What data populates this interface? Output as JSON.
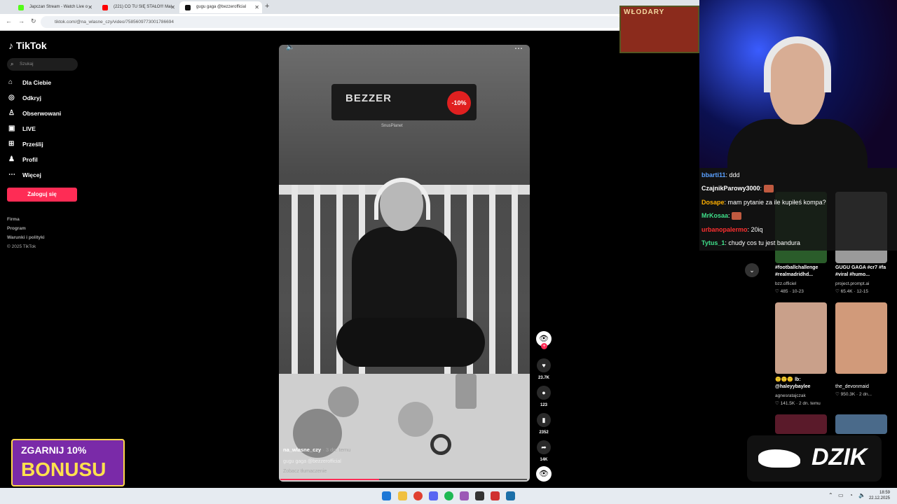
{
  "browser": {
    "tabs": [
      {
        "title": "Japczan Stream - Watch Live o",
        "fav_color": "#53fc18"
      },
      {
        "title": "(221) CO TU SIĘ STAŁO!!! Mai",
        "fav_color": "#ff0000"
      },
      {
        "title": "gugu gaga @bezzerofficial",
        "fav_color": "#111111"
      }
    ],
    "url": "tiktok.com/@na_wlasne_czy/video/7585609773001786694"
  },
  "tiktok": {
    "logo": "TikTok",
    "search_placeholder": "Szukaj",
    "menu": [
      {
        "label": "Dla Ciebie",
        "icon": "home-icon"
      },
      {
        "label": "Odkryj",
        "icon": "compass-icon"
      },
      {
        "label": "Obserwowani",
        "icon": "user-icon"
      },
      {
        "label": "LIVE",
        "icon": "live-icon"
      },
      {
        "label": "Prześlij",
        "icon": "upload-icon"
      },
      {
        "label": "Profil",
        "icon": "profile-icon"
      },
      {
        "label": "Więcej",
        "icon": "more-icon"
      }
    ],
    "login_label": "Zaloguj się",
    "footer": [
      "Firma",
      "Program",
      "Warunki i polityki",
      "© 2025 TikTok"
    ]
  },
  "video": {
    "ad_logo": "BEZZER",
    "ad_badge": "-10%",
    "ad_sub": "SnusPlanet",
    "author": "na_wlasne_czy",
    "posted": "· 3 dn. temu",
    "description": "gugu gaga @bezzerofficial",
    "translate": "Zobacz tłumaczenie",
    "progress": 0.4,
    "likes": "23.7K",
    "comments": "123",
    "saves": "2352",
    "shares": "14K"
  },
  "stream": {
    "frame_title": "WŁODARY"
  },
  "chat": [
    {
      "user": "bbarti11",
      "color": "#5aa0ff",
      "text": ": ddd",
      "emote": false
    },
    {
      "user": "CzajnikParowy3000",
      "color": "#ffffff",
      "text": ":",
      "emote": true
    },
    {
      "user": "Dosape",
      "color": "#ffb000",
      "text": ": mam pytanie za ile kupiłeś kompa?",
      "emote": false
    },
    {
      "user": "MrKosaa",
      "color": "#3fe08a",
      "text": ":",
      "emote": true
    },
    {
      "user": "urbanopalermo",
      "color": "#ff3030",
      "text": ": 20iq",
      "emote": false
    },
    {
      "user": "Tytus_1",
      "color": "#3fe08a",
      "text": ": chudy cos tu jest bandura",
      "emote": false
    }
  ],
  "recommendations": [
    {
      "title": "#footballchallenge #realmadridhd...",
      "user": "bzz.officiel",
      "meta": "♡ 485 · 10-23",
      "color": "#2a5c2a"
    },
    {
      "title": "GUGU GAGA #cr7 #fa #viral #humo...",
      "user": "project.prompt.ai",
      "meta": "♡ 65.4K · 12-15",
      "color": "#9a9a9a"
    },
    {
      "title": "🙂🙂🙂 lb: @haleyybaylee",
      "user": "agnesratajczak",
      "meta": "♡ 141.5K · 2 dn. temu",
      "color": "#c9a08a"
    },
    {
      "title": "the_devonmaid",
      "user": "",
      "meta": "♡ 950.3K · 2 dn...",
      "color": "#d19a7a"
    }
  ],
  "overlays": {
    "bonus_line1": "ZGARNIJ 10%",
    "bonus_line2": "BONUSU",
    "dzik": "DZIK"
  },
  "taskbar": {
    "time": "18:59",
    "date": "22.12.2025"
  }
}
